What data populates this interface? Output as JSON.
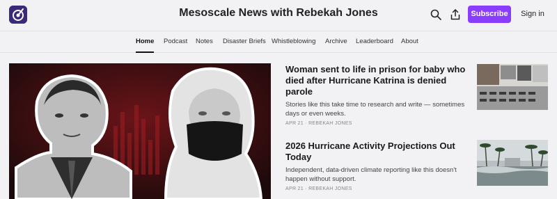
{
  "header": {
    "site_title": "Mesoscale News with Rebekah Jones",
    "subscribe_label": "Subscribe",
    "signin_label": "Sign in",
    "accent_color": "#8b3dff",
    "icons": [
      "search-icon",
      "share-icon"
    ]
  },
  "nav": {
    "items": [
      {
        "label": "Home",
        "active": true
      },
      {
        "label": "Podcast"
      },
      {
        "label": "Notes"
      },
      {
        "label": "Disaster Briefs"
      },
      {
        "label": "Whistleblowing"
      },
      {
        "label": "Archive"
      },
      {
        "label": "Leaderboard"
      },
      {
        "label": "About"
      }
    ]
  },
  "articles": [
    {
      "title": "Woman sent to life in prison for baby who died after Hurricane Katrina is denied parole",
      "subtitle": "Stories like this take time to research and write — sometimes days or even weeks.",
      "date": "APR 21",
      "author": "REBEKAH JONES"
    },
    {
      "title": "2026 Hurricane Activity Projections Out Today",
      "subtitle": "Independent, data-driven climate reporting like this doesn't happen without support.",
      "date": "APR 21",
      "author": "REBEKAH JONES"
    }
  ]
}
